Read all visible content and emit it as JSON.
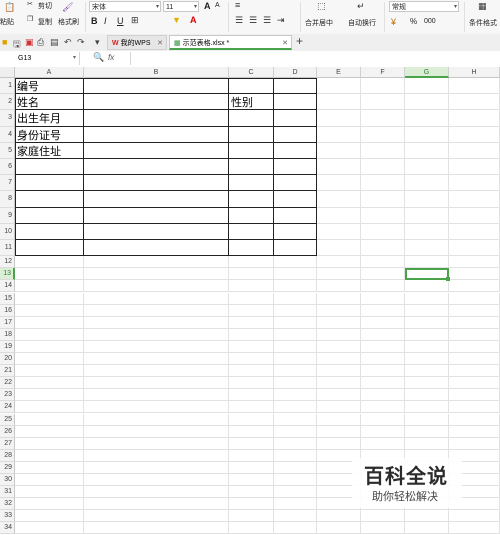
{
  "ribbon": {
    "paste_label": "粘贴",
    "cut_label": "剪切",
    "copy_label": "复制",
    "format_painter_label": "格式刷",
    "font_name": "宋体",
    "font_size": "11",
    "bold": "B",
    "italic": "I",
    "underline": "U",
    "grow_font": "A",
    "shrink_font": "A",
    "merge_center_label": "合并居中",
    "wrap_text_label": "自动换行",
    "number_format": "常规",
    "currency": "¥",
    "percent": "%",
    "comma": "000",
    "conditional_format_label": "条件格式"
  },
  "tabs": [
    {
      "label": "我的WPS",
      "active": false
    },
    {
      "label": "示范表格.xlsx *",
      "active": true
    }
  ],
  "formula_bar": {
    "name_box": "G13",
    "fx": "fx",
    "value": ""
  },
  "columns": [
    "A",
    "B",
    "C",
    "D",
    "E",
    "F",
    "G",
    "H"
  ],
  "rows": [
    "1",
    "2",
    "3",
    "4",
    "5",
    "6",
    "7",
    "8",
    "9",
    "10",
    "11",
    "12",
    "13",
    "14",
    "15",
    "16",
    "17",
    "18",
    "19",
    "20",
    "21",
    "22",
    "23",
    "24",
    "25",
    "26",
    "27",
    "28",
    "29",
    "30",
    "31",
    "32",
    "33",
    "34",
    "35",
    "36"
  ],
  "selected_cell": "G13",
  "cells": {
    "A1": "编号",
    "A2": "姓名",
    "C2": "性别",
    "A3": "出生年月",
    "A4": "身份证号",
    "A5": "家庭住址"
  },
  "watermark": {
    "line1": "百科全说",
    "line2": "助你轻松解决"
  }
}
